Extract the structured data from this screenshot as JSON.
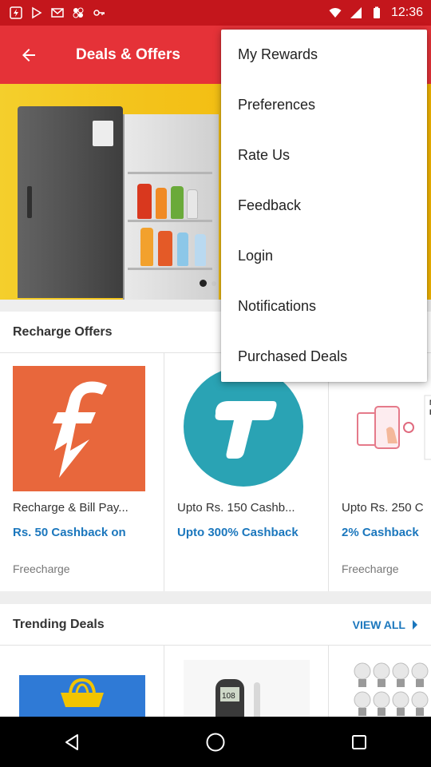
{
  "status_bar": {
    "time": "12:36",
    "icons": [
      "freecharge-icon",
      "play-store-icon",
      "gmail-icon",
      "photos-icon",
      "vpn-key-icon",
      "wifi-icon",
      "signal-icon",
      "battery-icon"
    ]
  },
  "app_bar": {
    "back_icon": "arrow-left-icon",
    "title": "Deals & Offers"
  },
  "banner": {
    "image": "refrigerator-product-image",
    "pager_pages": 3,
    "pager_active": 1
  },
  "recharge_offers": {
    "title": "Recharge Offers",
    "offers": [
      {
        "title": "Recharge & Bill Pay...",
        "subtitle": "Rs. 50 Cashback on",
        "brand": "Freecharge",
        "image": "freecharge-logo"
      },
      {
        "title": "Upto Rs. 150 Cashb...",
        "subtitle": "Upto 300% Cashback",
        "brand": "",
        "image": "truemoney-logo"
      },
      {
        "title": "Upto Rs. 250 C",
        "subtitle": "2% Cashback",
        "brand": "Freecharge",
        "image": "bill-payment-illustration"
      }
    ]
  },
  "trending_deals": {
    "title": "Trending Deals",
    "view_all_label": "VIEW ALL",
    "items": [
      {
        "image": "shopping-bag-banner"
      },
      {
        "image": "glucometer-product"
      },
      {
        "image": "led-bulbs-product"
      }
    ]
  },
  "overflow_menu": {
    "items": [
      "My Rewards",
      "Preferences",
      "Rate Us",
      "Feedback",
      "Login",
      "Notifications",
      "Purchased Deals"
    ]
  },
  "nav_bar": {
    "buttons": [
      "back-triangle-icon",
      "home-circle-icon",
      "recents-square-icon"
    ]
  },
  "colors": {
    "status_bar": "#c4161c",
    "app_bar": "#e53238",
    "accent_blue": "#1b77bd",
    "banner_yellow": "#f3c21a",
    "freecharge_orange": "#e8673c",
    "truemoney_teal": "#2aa3b4"
  }
}
